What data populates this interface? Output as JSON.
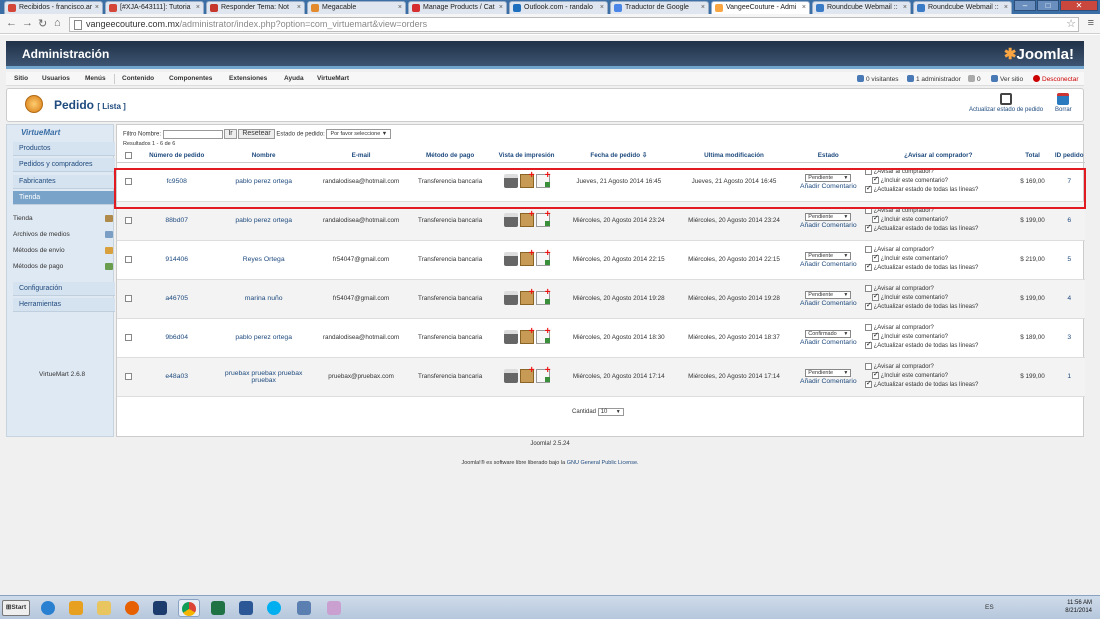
{
  "browser": {
    "tabs": [
      {
        "label": "Recibidos - francisco.ar",
        "color": "#d44638"
      },
      {
        "label": "[#XJA-643111]: Tutoria",
        "color": "#d44638"
      },
      {
        "label": "Responder Tema: Not",
        "color": "#c6372c"
      },
      {
        "label": "Megacable",
        "color": "#e38b2c"
      },
      {
        "label": "Manage Products / Cat",
        "color": "#d62e2e"
      },
      {
        "label": "Outlook.com - randalo",
        "color": "#1e6fbd"
      },
      {
        "label": "Traductor de Google",
        "color": "#4a86e8"
      },
      {
        "label": "VangeeCouture - Admi",
        "color": "#f9a541"
      },
      {
        "label": "Roundcube Webmail ::",
        "color": "#3a7bc8"
      },
      {
        "label": "Roundcube Webmail ::",
        "color": "#3a7bc8"
      }
    ],
    "url_main": "vangeecouture.com.mx",
    "url_rest": "/administrator/index.php?option=com_virtuemart&view=orders"
  },
  "header": {
    "title": "Administración",
    "logo": "Joomla!"
  },
  "menubar": {
    "items": [
      "Sitio",
      "Usuarios",
      "Menús",
      "Contenido",
      "Componentes",
      "Extensiones",
      "Ayuda",
      "VirtueMart"
    ],
    "status": {
      "visitors": "0 visitantes",
      "admins": "1 administrador",
      "count": "0",
      "view_site": "Ver sitio",
      "logout": "Desconectar"
    }
  },
  "toolbar": {
    "title": "Pedido",
    "subtitle": "[ Lista ]",
    "update_label": "Actualizar estado de pedido",
    "delete_label": "Borrar"
  },
  "sidebar": {
    "logo": "VirtueMart",
    "items": [
      "Productos",
      "Pedidos y compradores",
      "Fabricantes",
      "Tienda"
    ],
    "sub": [
      "Tienda",
      "Archivos de medios",
      "Métodos de envío",
      "Métodos de pago"
    ],
    "items2": [
      "Configuración",
      "Herramientas"
    ],
    "version": "VirtueMart 2.6.8"
  },
  "filter": {
    "label": "Filtro Nombre:",
    "go": "Ir",
    "reset": "Resetear",
    "status_label": "Estado de pedido:",
    "status_value": "Por favor seleccione",
    "results": "Resultados 1 - 6 de 6"
  },
  "table": {
    "headers": [
      "Número de pedido",
      "Nombre",
      "E-mail",
      "Método de pago",
      "Vista de impresión",
      "Fecha de pedido",
      "Ultima modificación",
      "Estado",
      "¿Avisar al comprador?",
      "Total",
      "ID pedido"
    ],
    "notify": {
      "avisar": "¿Avisar al comprador?",
      "incluir": "¿Incluir este comentario?",
      "actualizar": "¿Actualizar estado de todas las líneas?"
    },
    "add_comment": "Añadir Comentario",
    "rows": [
      {
        "num": "fc9508",
        "name": "pablo perez ortega",
        "email": "randalodisea@hotmail.com",
        "payment": "Transferencia bancaria",
        "date": "Jueves, 21 Agosto 2014 16:45",
        "modified": "Jueves, 21 Agosto 2014 16:45",
        "status": "Pendiente",
        "total": "$ 169,00",
        "id": "7"
      },
      {
        "num": "88bd07",
        "name": "pablo perez ortega",
        "email": "randalodisea@hotmail.com",
        "payment": "Transferencia bancaria",
        "date": "Miércoles, 20 Agosto 2014 23:24",
        "modified": "Miércoles, 20 Agosto 2014 23:24",
        "status": "Pendiente",
        "total": "$ 199,00",
        "id": "6"
      },
      {
        "num": "914406",
        "name": "Reyes Ortega",
        "email": "fr54047@gmail.com",
        "payment": "Transferencia bancaria",
        "date": "Miércoles, 20 Agosto 2014 22:15",
        "modified": "Miércoles, 20 Agosto 2014 22:15",
        "status": "Pendiente",
        "total": "$ 219,00",
        "id": "5"
      },
      {
        "num": "a46705",
        "name": "marina nuño",
        "email": "fr54047@gmail.com",
        "payment": "Transferencia bancaria",
        "date": "Miércoles, 20 Agosto 2014 19:28",
        "modified": "Miércoles, 20 Agosto 2014 19:28",
        "status": "Pendiente",
        "total": "$ 199,00",
        "id": "4"
      },
      {
        "num": "9b6d04",
        "name": "pablo perez ortega",
        "email": "randalodisea@hotmail.com",
        "payment": "Transferencia bancaria",
        "date": "Miércoles, 20 Agosto 2014 18:30",
        "modified": "Miércoles, 20 Agosto 2014 18:37",
        "status": "Confirmado",
        "total": "$ 189,00",
        "id": "3"
      },
      {
        "num": "e48a03",
        "name": "pruebax pruebax pruebax pruebax",
        "email": "pruebax@pruebax.com",
        "payment": "Transferencia bancaria",
        "date": "Miércoles, 20 Agosto 2014 17:14",
        "modified": "Miércoles, 20 Agosto 2014 17:14",
        "status": "Pendiente",
        "total": "$ 199,00",
        "id": "1"
      }
    ]
  },
  "pagination": {
    "label": "Cantidad",
    "value": "10"
  },
  "footer": {
    "version": "Joomla! 2.5.24",
    "license_prefix": "Joomla!® es software libre liberado bajo la",
    "license_link": "GNU General Public License."
  },
  "taskbar": {
    "start": "Start",
    "lang": "ES",
    "time": "11:56 AM",
    "date": "8/21/2014"
  }
}
